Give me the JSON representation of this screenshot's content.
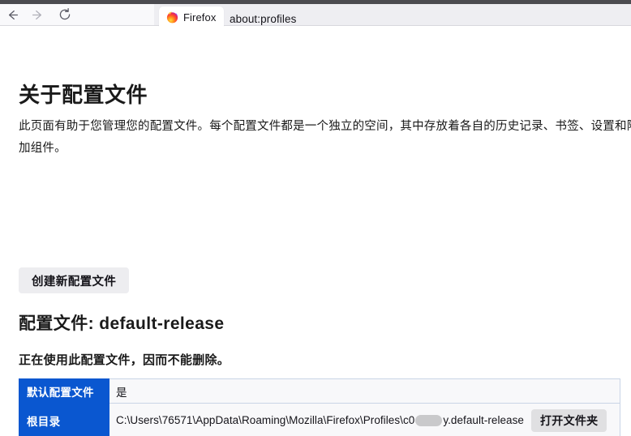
{
  "browser": {
    "nav": {
      "back_label": "后退",
      "forward_label": "前进",
      "reload_label": "重新载入"
    },
    "tab": {
      "title": "Firefox",
      "favicon": "firefox-logo-icon"
    },
    "urlbar": {
      "value": "about:profiles"
    }
  },
  "page": {
    "title": "关于配置文件",
    "description": "此页面有助于您管理您的配置文件。每个配置文件都是一个独立的空间，其中存放着各自的历史记录、书签、设置和附加组件。",
    "create_button": "创建新配置文件",
    "profile_heading": "配置文件: default-release",
    "in_use_note": "正在使用此配置文件，因而不能删除。",
    "table": {
      "rows": [
        {
          "header": "默认配置文件",
          "value": "是"
        },
        {
          "header": "根目录",
          "path_prefix": "C:\\Users\\76571\\AppData\\Roaming\\Mozilla\\Firefox\\Profiles\\c0",
          "path_suffix": "y.default-release",
          "redacted": true,
          "open_folder_button": "打开文件夹"
        }
      ]
    }
  },
  "colors": {
    "table_header_blue": "#0a57d0",
    "button_gray": "#e0e0e2",
    "toolbar_bg": "#eeeef2",
    "titlebar_dark": "#4b4b50",
    "redaction_gray": "#c9c9cb"
  }
}
